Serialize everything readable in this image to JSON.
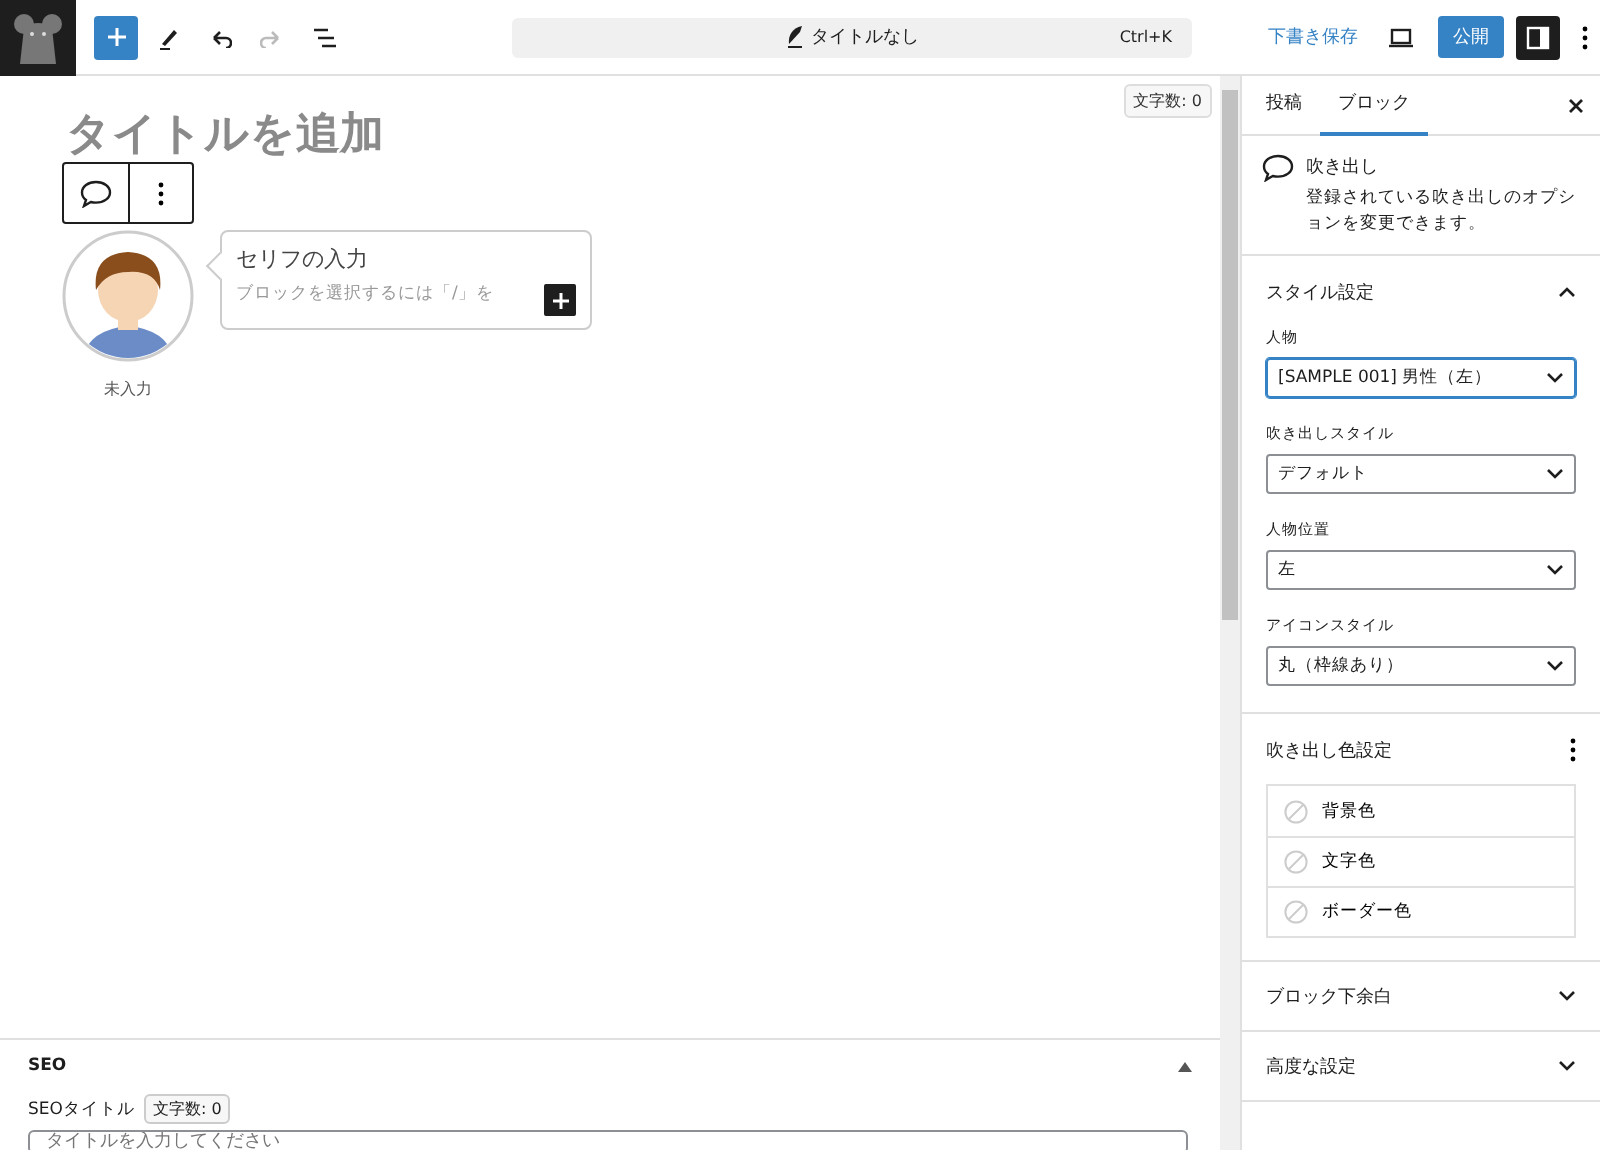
{
  "top_bar": {
    "title": "タイトルなし",
    "shortcut": "Ctrl+K",
    "redo_disabled": true,
    "save_draft": "下書き保存",
    "publish": "公開",
    "settings_pressed": true
  },
  "editor": {
    "word_count": "文字数: 0",
    "title_placeholder": "タイトルを追加",
    "speech": {
      "name": "未入力",
      "text_placeholder": "セリフの入力",
      "block_placeholder": "ブロックを選択するには「/」を"
    }
  },
  "seo": {
    "heading": "SEO",
    "expanded": true,
    "title_label": "SEOタイトル",
    "count": "文字数: 0",
    "placeholder": "タイトルを入力してください"
  },
  "sidebar": {
    "tabs": [
      {
        "label": "投稿",
        "selected": false
      },
      {
        "label": "ブロック",
        "selected": true
      }
    ],
    "block": {
      "name": "吹き出し",
      "description": "登録されている吹き出しのオプションを変更できます。"
    },
    "panels": [
      {
        "kind": "fields",
        "title": "スタイル設定",
        "expanded": true,
        "fields": [
          {
            "label": "人物",
            "value": "[SAMPLE 001] 男性（左）",
            "focused": true
          },
          {
            "label": "吹き出しスタイル",
            "value": "デフォルト",
            "focused": false
          },
          {
            "label": "人物位置",
            "value": "左",
            "focused": false
          },
          {
            "label": "アイコンスタイル",
            "value": "丸（枠線あり）",
            "focused": false
          }
        ]
      },
      {
        "kind": "colors",
        "title": "吹き出し色設定",
        "items": [
          "背景色",
          "文字色",
          "ボーダー色"
        ]
      },
      {
        "kind": "section",
        "title": "ブロック下余白",
        "expanded": false
      },
      {
        "kind": "section",
        "title": "高度な設定",
        "expanded": false
      }
    ]
  }
}
